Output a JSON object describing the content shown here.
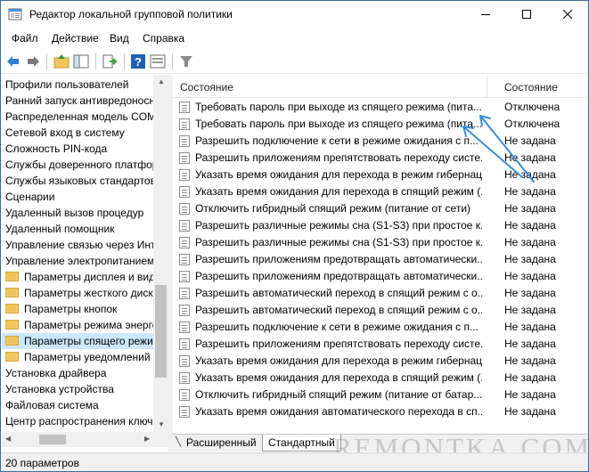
{
  "window": {
    "title": "Редактор локальной групповой политики"
  },
  "menu": {
    "items": [
      "Файл",
      "Действие",
      "Вид",
      "Справка"
    ]
  },
  "tree": {
    "items": [
      {
        "label": "Профили пользователей",
        "folder": false
      },
      {
        "label": "Ранний запуск антивредоносн",
        "folder": false
      },
      {
        "label": "Распределенная модель COM",
        "folder": false
      },
      {
        "label": "Сетевой вход в систему",
        "folder": false
      },
      {
        "label": "Сложность PIN-кода",
        "folder": false
      },
      {
        "label": "Службы доверенного платфор",
        "folder": false
      },
      {
        "label": "Службы языковых стандартов",
        "folder": false
      },
      {
        "label": "Сценарии",
        "folder": false
      },
      {
        "label": "Удаленный вызов процедур",
        "folder": false
      },
      {
        "label": "Удаленный помощник",
        "folder": false
      },
      {
        "label": "Управление связью через Инт",
        "folder": false
      },
      {
        "label": "Управление электропитанием",
        "folder": false
      },
      {
        "label": "Параметры дисплея и виде",
        "folder": true
      },
      {
        "label": "Параметры жесткого диск",
        "folder": true
      },
      {
        "label": "Параметры кнопок",
        "folder": true
      },
      {
        "label": "Параметры режима энерго",
        "folder": true
      },
      {
        "label": "Параметры спящего режи",
        "folder": true,
        "selected": true
      },
      {
        "label": "Параметры уведомлений",
        "folder": true
      },
      {
        "label": "Установка драйвера",
        "folder": false
      },
      {
        "label": "Установка устройства",
        "folder": false
      },
      {
        "label": "Файловая система",
        "folder": false
      },
      {
        "label": "Центр распространения ключ",
        "folder": false
      }
    ]
  },
  "list": {
    "header_name": "Состояние",
    "header_state": "Состояние",
    "rows": [
      {
        "name": "Требовать пароль при выходе из спящего режима (пита...",
        "state": "Отключена"
      },
      {
        "name": "Требовать пароль при выходе из спящего режима (пита...",
        "state": "Отключена"
      },
      {
        "name": "Разрешить подключение к сети в режиме ожидания с п...",
        "state": "Не задана"
      },
      {
        "name": "Разрешить приложениям препятствовать переходу систе...",
        "state": "Не задана"
      },
      {
        "name": "Указать время ожидания для перехода в режим гибернац...",
        "state": "Не задана"
      },
      {
        "name": "Указать время ожидания для перехода в спящий режим (...",
        "state": "Не задана"
      },
      {
        "name": "Отключить гибридный спящий режим (питание от сети)",
        "state": "Не задана"
      },
      {
        "name": "Разрешить различные режимы сна (S1-S3) при простое к...",
        "state": "Не задана"
      },
      {
        "name": "Разрешить различные режимы сна (S1-S3) при простое к...",
        "state": "Не задана"
      },
      {
        "name": "Разрешить приложениям предотвращать автоматически...",
        "state": "Не задана"
      },
      {
        "name": "Разрешить приложениям предотвращать автоматически...",
        "state": "Не задана"
      },
      {
        "name": "Разрешить автоматический переход в спящий режим с о...",
        "state": "Не задана"
      },
      {
        "name": "Разрешить автоматический переход в спящий режим с о...",
        "state": "Не задана"
      },
      {
        "name": "Разрешить подключение к сети в режиме ожидания с п...",
        "state": "Не задана"
      },
      {
        "name": "Разрешить приложениям препятствовать переходу систе...",
        "state": "Не задана"
      },
      {
        "name": "Указать время ожидания для перехода в режим гибернац...",
        "state": "Не задана"
      },
      {
        "name": "Указать время ожидания для перехода в спящий режим (...",
        "state": "Не задана"
      },
      {
        "name": "Отключить гибридный спящий режим (питание от батар...",
        "state": "Не задана"
      },
      {
        "name": "Указать время ожидания автоматического перехода в сп...",
        "state": "Не задана"
      }
    ]
  },
  "tabs": {
    "extended": "Расширенный",
    "standard": "Стандартный"
  },
  "status": {
    "text": "20 параметров"
  },
  "watermark": "REMONTKA.COM",
  "colors": {
    "selection": "#cce8ff",
    "arrow": "#3a8fd6",
    "toolbar_back": "#2f80d1",
    "help": "#1f5fb5"
  }
}
